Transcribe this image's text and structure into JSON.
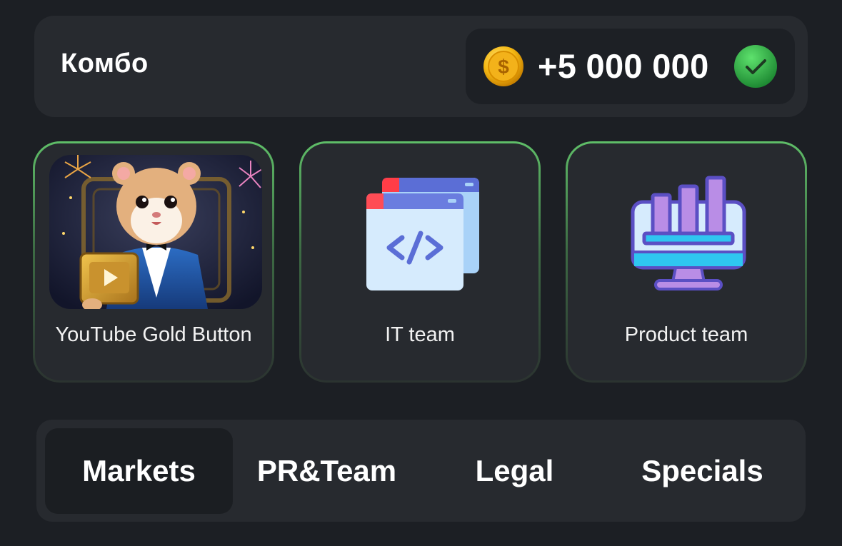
{
  "combo": {
    "title": "Комбо",
    "reward": "+5 000 000",
    "coin_icon": "gold-coin-dollar-icon",
    "status_icon": "green-check-icon",
    "accent_color": "#5fbe68"
  },
  "cards": [
    {
      "label": "YouTube Gold Button",
      "image": "hamster-holding-gold-play-button"
    },
    {
      "label": "IT team",
      "icon": "code-windows-icon"
    },
    {
      "label": "Product team",
      "icon": "bar-chart-monitor-icon"
    }
  ],
  "tabs": [
    {
      "label": "Markets",
      "active": true
    },
    {
      "label": "PR&Team",
      "active": false
    },
    {
      "label": "Legal",
      "active": false
    },
    {
      "label": "Specials",
      "active": false
    }
  ]
}
